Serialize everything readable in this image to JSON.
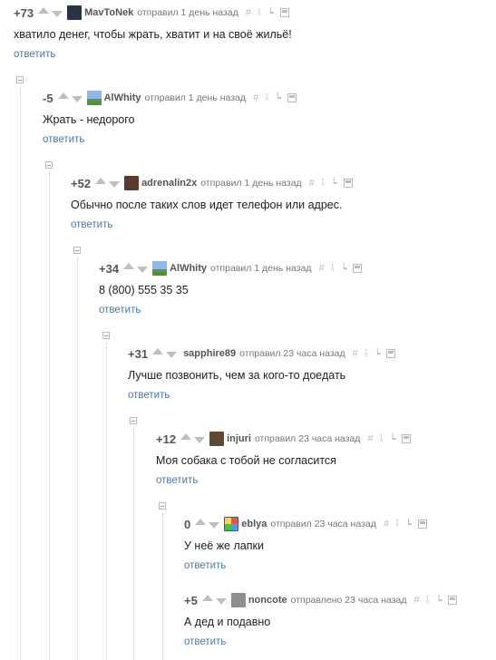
{
  "tool_icons": [
    "hash-icon",
    "pin-icon",
    "tree-icon",
    "save-icon"
  ],
  "tool_glyphs": {
    "hash": "#",
    "pin": "⫱",
    "tree": "┕"
  },
  "reply_label": "ответить",
  "comments": [
    {
      "rating": "+73",
      "author": "MavToNek",
      "meta": "отправил 1 день назад",
      "text": "хватило денег, чтобы жрать, хватит и на своё жильё!",
      "avatar": "dark-figure"
    },
    {
      "rating": "-5",
      "author": "AlWhity",
      "meta": "отправил 1 день назад",
      "text": "Жрать - недорого",
      "avatar": "landscape"
    },
    {
      "rating": "+52",
      "author": "adrenalin2x",
      "meta": "отправил 1 день назад",
      "text": "Обычно после таких слов идет телефон или адрес.",
      "avatar": "portrait"
    },
    {
      "rating": "+34",
      "author": "AlWhity",
      "meta": "отправил 1 день назад",
      "text": "8 (800) 555 35 35",
      "avatar": "landscape"
    },
    {
      "rating": "+31",
      "author": "sapphire89",
      "meta": "отправил 23 часа назад",
      "text": "Лучше позвонить, чем за кого-то доедать",
      "avatar": "none"
    },
    {
      "rating": "+12",
      "author": "injuri",
      "meta": "отправил 23 часа назад",
      "text": "Моя собака с тобой не согласится",
      "avatar": "portrait"
    },
    {
      "rating": "0",
      "author": "eblya",
      "meta": "отправил 23 часа назад",
      "text": "У неё же лапки",
      "avatar": "colorful"
    },
    {
      "rating": "+5",
      "author": "noncote",
      "meta": "отправлено 23 часа назад",
      "text": "А дед и подавно",
      "avatar": "gray"
    }
  ]
}
